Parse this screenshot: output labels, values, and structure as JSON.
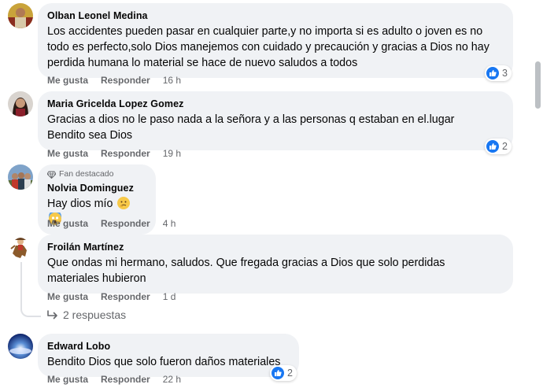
{
  "comments": [
    {
      "author": "Olban Leonel Medina",
      "text": "Los accidentes pueden pasar en cualquier parte,y no importa si es adulto o joven es no todo es perfecto,solo Dios manejemos con cuidado y precaución y gracias a Dios no hay perdida humana lo material se hace de nuevo saludos a todos",
      "like_label": "Me gusta",
      "reply_label": "Responder",
      "time": "16 h",
      "reactions": "3"
    },
    {
      "author": "Maria Gricelda Lopez Gomez",
      "text": "Gracias a dios no le paso nada a la señora y a las personas q estaban en el.lugar Bendito sea Dios",
      "like_label": "Me gusta",
      "reply_label": "Responder",
      "time": "19 h",
      "reactions": "2"
    },
    {
      "badge": "Fan destacado",
      "author": "Nolvia Dominguez",
      "text": "Hay dios mío",
      "like_label": "Me gusta",
      "reply_label": "Responder",
      "time": "4 h"
    },
    {
      "author": "Froilán Martínez",
      "text": "Que ondas mi hermano, saludos. Que fregada gracias a Dios que solo perdidas materiales hubieron",
      "like_label": "Me gusta",
      "reply_label": "Responder",
      "time": "1 d",
      "replies_label": "2 respuestas"
    },
    {
      "author": "Edward Lobo",
      "text": "Bendito Dios que solo fueron daños materiales",
      "like_label": "Me gusta",
      "reply_label": "Responder",
      "time": "22 h",
      "reactions": "2"
    }
  ],
  "colors": {
    "bubble": "#f0f2f5",
    "like_blue": "#1877f2",
    "meta_gray": "#65676b"
  }
}
